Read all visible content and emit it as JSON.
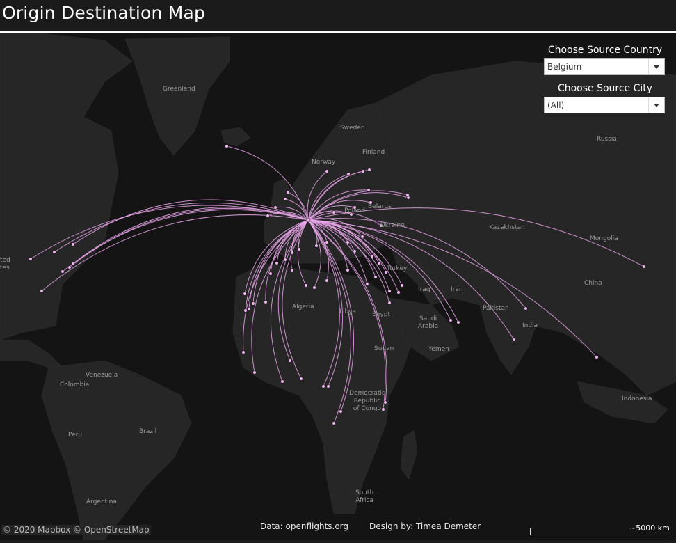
{
  "header": {
    "title": "Origin Destination Map"
  },
  "controls": {
    "country_label": "Choose Source Country",
    "country_value": "Belgium",
    "city_label": "Choose Source City",
    "city_value": "(All)"
  },
  "map_labels": {
    "greenland": "Greenland",
    "sweden": "Sweden",
    "finland": "Finland",
    "norway": "Norway",
    "russia": "Russia",
    "poland": "Poland",
    "belarus": "Belarus",
    "ukraine": "Ukraine",
    "kazakhstan": "Kazakhstan",
    "mongolia": "Mongolia",
    "china": "China",
    "turkey": "Turkey",
    "iraq": "Iraq",
    "iran": "Iran",
    "pakistan": "Pakistan",
    "india": "India",
    "saudi_arabia": "Saudi\nArabia",
    "yemen": "Yemen",
    "egypt": "Egypt",
    "libya": "Libya",
    "algeria": "Algeria",
    "sudan": "Sudan",
    "drc": "Democratic\nRepublic\nof Congo",
    "south_africa": "South\nAfrica",
    "venezuela": "Venezuela",
    "colombia": "Colombia",
    "peru": "Peru",
    "brazil": "Brazil",
    "argentina": "Argentina",
    "indonesia": "Indonesia",
    "united_states": "ted\ntes"
  },
  "footer": {
    "data_credit": "Data: openflights.org",
    "design_credit": "Design by: Timea Demeter",
    "attribution": "© 2020 Mapbox © OpenStreetMap",
    "scale": "~5000 km"
  },
  "colors": {
    "route": "#e9a6ea",
    "dot_fill": "#f2b6f2",
    "land": "#262626",
    "water": "#141414"
  }
}
